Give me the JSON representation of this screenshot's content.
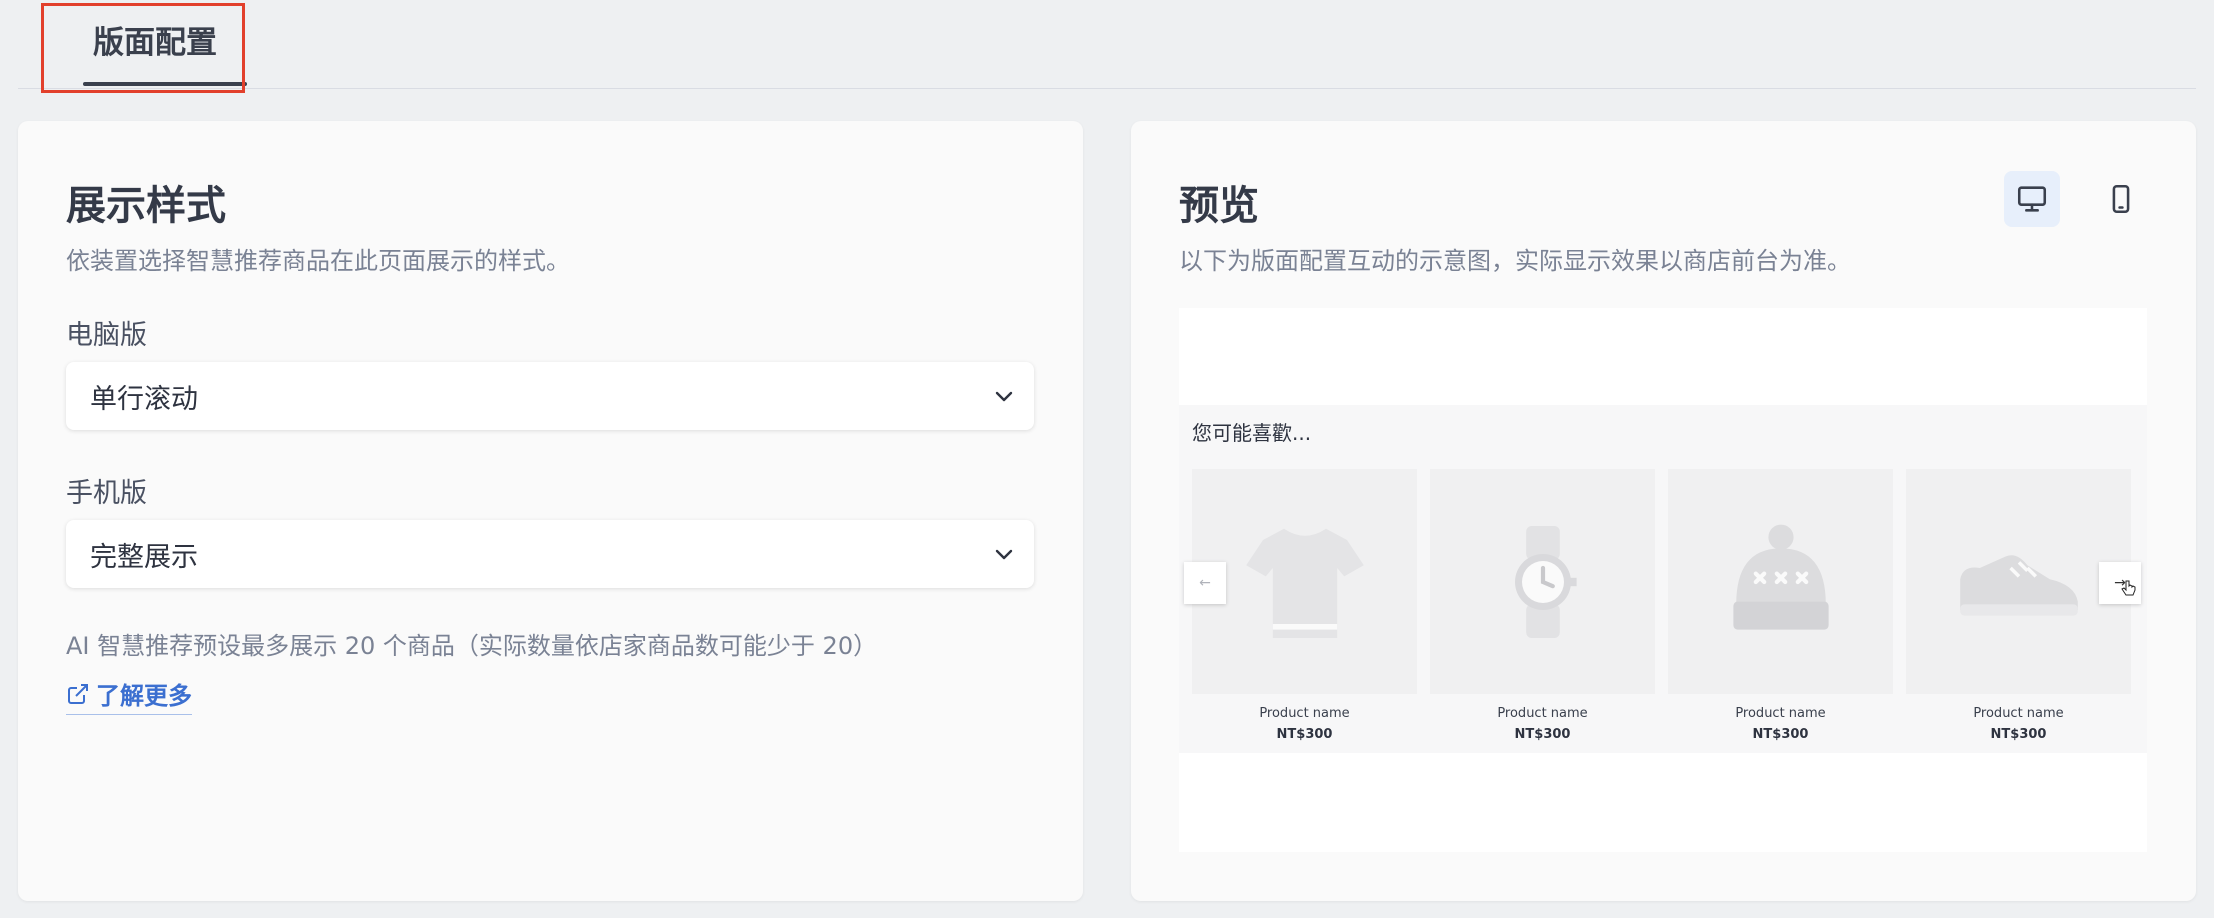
{
  "tabs": [
    {
      "label": "版面配置",
      "active": true
    }
  ],
  "left": {
    "title": "展示样式",
    "description": "依装置选择智慧推荐商品在此页面展示的样式。",
    "desktop_label": "电脑版",
    "desktop_value": "单行滚动",
    "mobile_label": "手机版",
    "mobile_value": "完整展示",
    "note": "AI 智慧推荐预设最多展示 20 个商品（实际数量依店家商品数可能少于 20）",
    "learn_more": "了解更多"
  },
  "right": {
    "title": "预览",
    "description": "以下为版面配置互动的示意图，实际显示效果以商店前台为准。",
    "device_buttons": [
      {
        "icon": "desktop-icon",
        "selected": true
      },
      {
        "icon": "mobile-icon",
        "selected": false
      }
    ],
    "preview": {
      "heading": "您可能喜歡...",
      "products": [
        {
          "icon": "tshirt-icon",
          "name": "Product name",
          "price": "NT$300"
        },
        {
          "icon": "watch-icon",
          "name": "Product name",
          "price": "NT$300"
        },
        {
          "icon": "beanie-icon",
          "name": "Product name",
          "price": "NT$300"
        },
        {
          "icon": "sneaker-icon",
          "name": "Product name",
          "price": "NT$300"
        }
      ],
      "prev_arrow": "←",
      "next_arrow": "→"
    }
  },
  "colors": {
    "accent": "#3b6fd0",
    "highlight_border": "#e2402c",
    "background": "#eef0f2"
  }
}
